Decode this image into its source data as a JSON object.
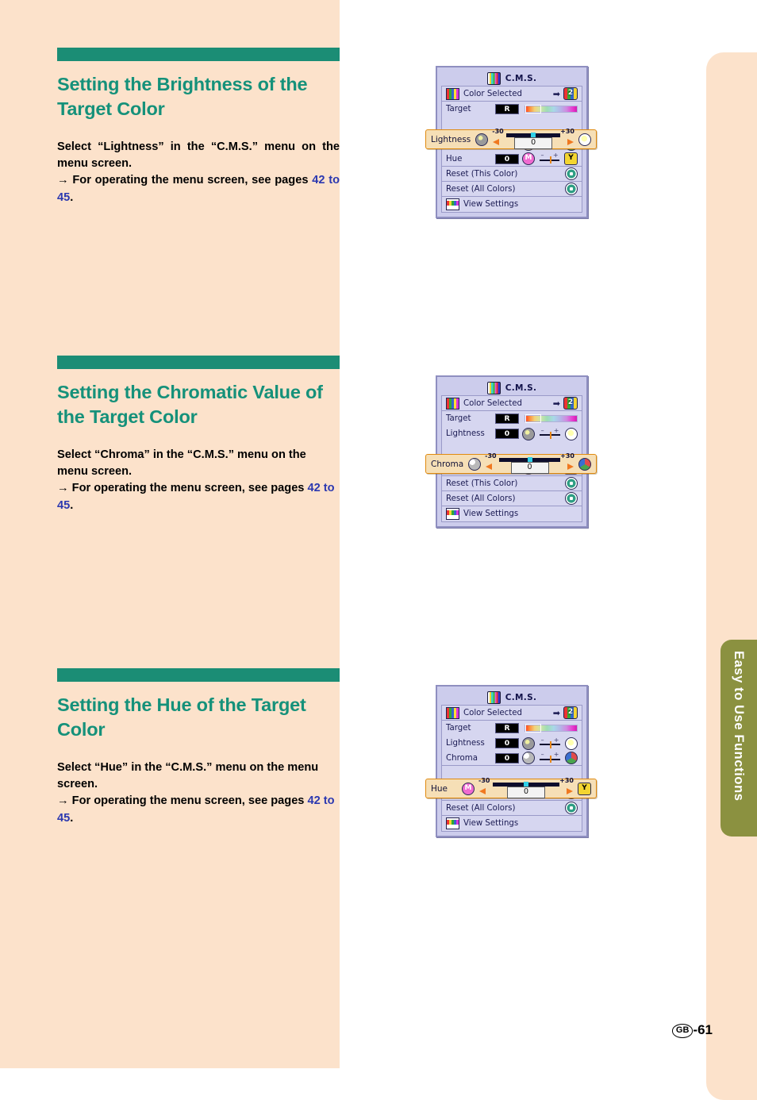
{
  "page": {
    "footer_mark": "GB",
    "footer_number": "-61",
    "side_tab": "Easy to Use Functions"
  },
  "sections": [
    {
      "heading": "Setting the Brightness of the Target Color",
      "body_line1": "Select “Lightness” in the “C.M.S.” menu on the menu screen.",
      "body_arrow": "→",
      "body_line2": " For operating the menu screen, see pages ",
      "page_link": "42 to 45",
      "body_end": "."
    },
    {
      "heading": "Setting the Chromatic Value of the Target Color",
      "body_line1": "Select “Chroma” in the “C.M.S.” menu on the menu screen.",
      "body_arrow": "→",
      "body_line2": " For operating the menu screen, see pages ",
      "page_link": "42 to 45",
      "body_end": "."
    },
    {
      "heading": "Setting the Hue of the Target Color",
      "body_line1": "Select “Hue” in the “C.M.S.” menu on the menu screen.",
      "body_arrow": "→",
      "body_line2": " For operating the menu screen, see pages ",
      "page_link": "42 to 45",
      "body_end": "."
    }
  ],
  "osd": {
    "title": "C.M.S.",
    "color_selected": "Color Selected",
    "color_selected_value": "2",
    "target_label": "Target",
    "target_value": "R",
    "lightness_label": "Lightness",
    "lightness_value": "0",
    "chroma_label": "Chroma",
    "chroma_value": "0",
    "hue_label": "Hue",
    "hue_value": "0",
    "reset_this": "Reset (This Color)",
    "reset_all": "Reset (All Colors)",
    "view_settings": "View Settings",
    "slider_min": "-30",
    "slider_max": "+30",
    "tick_minus": "–",
    "tick_plus": "+",
    "highlight_value": "0",
    "arrow_right": "➡",
    "icon_mag_letter": "M",
    "icon_yel_letter": "Y"
  },
  "colors": {
    "page_bg": "#fce2cb",
    "heading_green": "#15917a",
    "rule_green": "#1b8d75",
    "link_blue": "#2b38b0",
    "tab_olive": "#8b9140",
    "osd_bg": "#ccccec",
    "osd_panel": "#d6d6f0",
    "highlight_bg": "#f6dfb6",
    "highlight_border": "#e08a10"
  }
}
